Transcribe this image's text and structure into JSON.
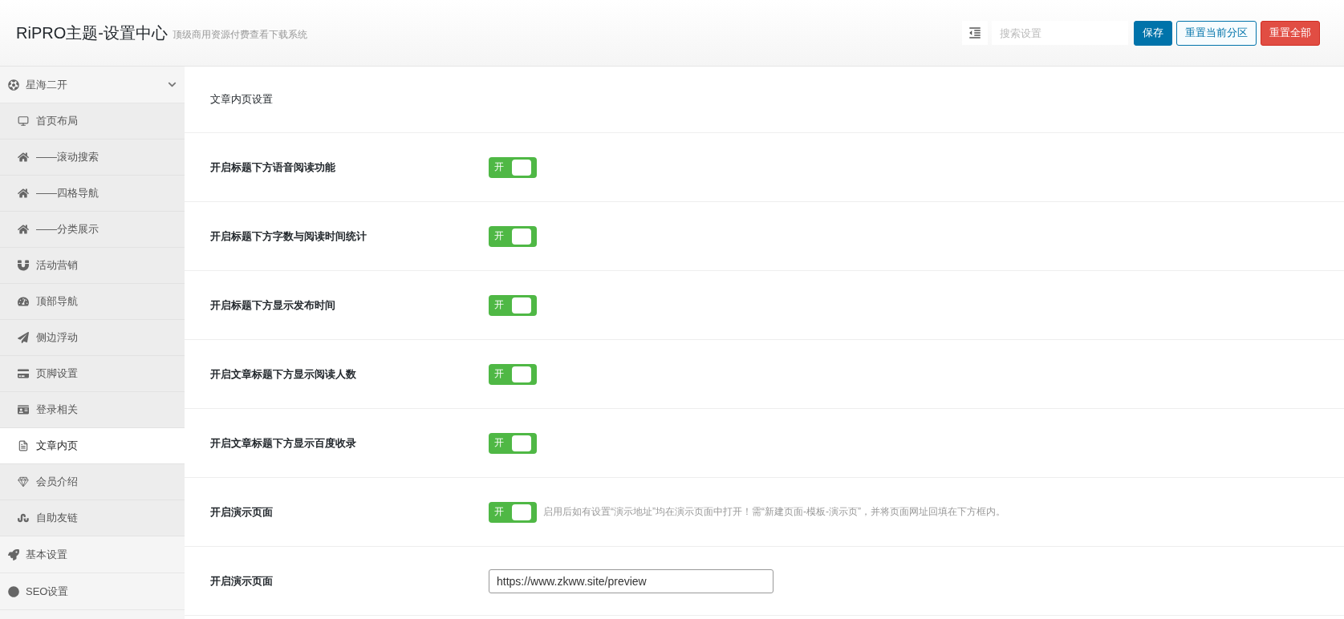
{
  "header": {
    "title": "RiPRO主题-设置中心",
    "subtitle": "顶级商用资源付费查看下载系统",
    "search": {
      "placeholder": "搜索设置"
    },
    "buttons": [
      {
        "kind": "primary",
        "label": "保存"
      },
      {
        "kind": "outline",
        "label": "重置当前分区"
      },
      {
        "kind": "danger",
        "label": "重置全部"
      }
    ]
  },
  "sidebar": {
    "items": [
      {
        "label": "星海二开",
        "expanded": true,
        "children": [
          {
            "label": "首页布局",
            "selected": false
          },
          {
            "label": "——滚动搜索",
            "selected": false
          },
          {
            "label": "——四格导航",
            "selected": false
          },
          {
            "label": "——分类展示",
            "selected": false
          },
          {
            "label": "活动营销",
            "selected": false
          },
          {
            "label": "顶部导航",
            "selected": false
          },
          {
            "label": "侧边浮动",
            "selected": false
          },
          {
            "label": "页脚设置",
            "selected": false
          },
          {
            "label": "登录相关",
            "selected": false
          },
          {
            "label": "文章内页",
            "selected": true
          },
          {
            "label": "会员介绍",
            "selected": false
          },
          {
            "label": "自助友链",
            "selected": false
          }
        ]
      },
      {
        "label": "基本设置"
      },
      {
        "label": "SEO设置"
      }
    ]
  },
  "section": {
    "title": "文章内页设置",
    "fields": [
      {
        "kind": "switch",
        "label": "开启标题下方语音阅读功能",
        "on": true,
        "switch_label": "开"
      },
      {
        "kind": "switch",
        "label": "开启标题下方字数与阅读时间统计",
        "on": true,
        "switch_label": "开"
      },
      {
        "kind": "switch",
        "label": "开启标题下方显示发布时间",
        "on": true,
        "switch_label": "开"
      },
      {
        "kind": "switch",
        "label": "开启文章标题下方显示阅读人数",
        "on": true,
        "switch_label": "开"
      },
      {
        "kind": "switch",
        "label": "开启文章标题下方显示百度收录",
        "on": true,
        "switch_label": "开"
      },
      {
        "kind": "switch",
        "label": "开启演示页面",
        "on": true,
        "switch_label": "开",
        "help": "启用后如有设置“演示地址”均在演示页面中打开！需“新建页面-模板-演示页”，并将页面网址回填在下方框内。"
      },
      {
        "kind": "text",
        "label": "开启演示页面",
        "value": "https://www.zkww.site/preview"
      }
    ]
  }
}
